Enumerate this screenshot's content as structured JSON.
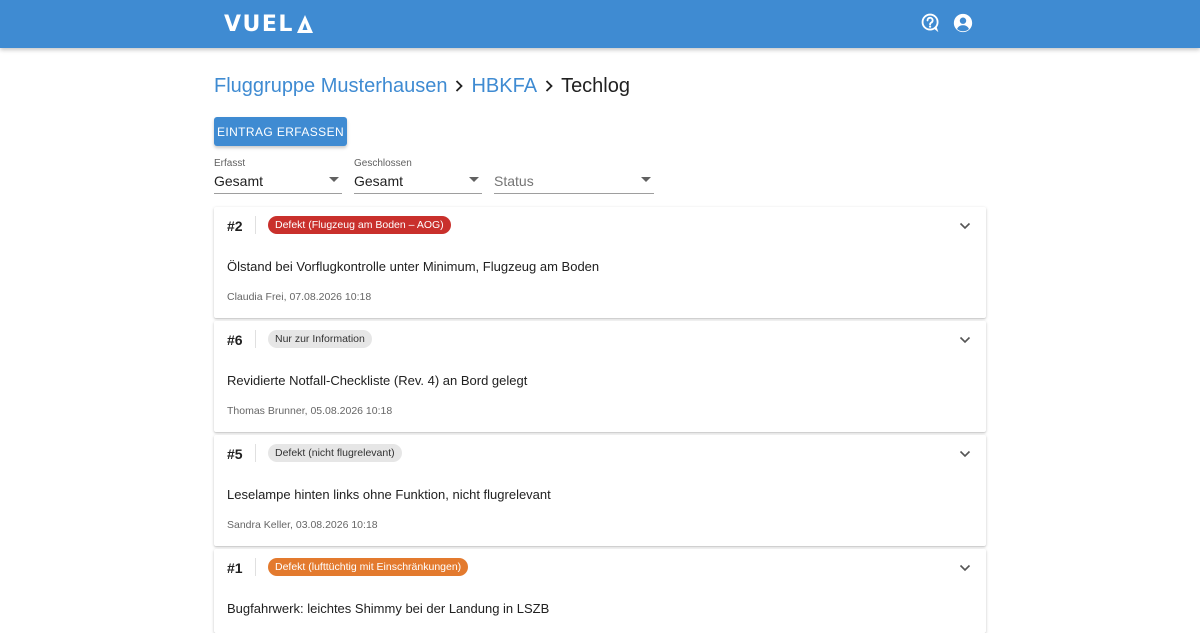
{
  "appbar": {
    "logo_text": "VUEL",
    "logo_mark": "triangle-a-mark",
    "help_icon": "help-circle-icon",
    "account_icon": "account-circle-icon",
    "color": "#3f8bd2"
  },
  "breadcrumb": {
    "group": "Fluggruppe Musterhausen",
    "aircraft": "HBKFA",
    "current": "Techlog"
  },
  "actions": {
    "add_entry": "Eintrag erfassen"
  },
  "filters": {
    "recorded": {
      "label": "Erfasst",
      "value": "Gesamt"
    },
    "closed": {
      "label": "Geschlossen",
      "value": "Gesamt"
    },
    "status": {
      "placeholder": "Status"
    }
  },
  "entries": [
    {
      "id": "#2",
      "status": "Defekt (Flugzeug am Boden – AOG)",
      "status_color": "#c9302c",
      "title": "Ölstand bei Vorflugkontrolle unter Minimum, Flugzeug am Boden",
      "meta": "Claudia Frei, 07.08.2026 10:18"
    },
    {
      "id": "#6",
      "status": "Nur zur Information",
      "status_color": "#e6e6e6",
      "title": "Revidierte Notfall-Checkliste (Rev. 4) an Bord gelegt",
      "meta": "Thomas Brunner, 05.08.2026 10:18"
    },
    {
      "id": "#5",
      "status": "Defekt (nicht flugrelevant)",
      "status_color": "#e6e6e6",
      "title": "Leselampe hinten links ohne Funktion, nicht flugrelevant",
      "meta": "Sandra Keller, 03.08.2026 10:18"
    },
    {
      "id": "#1",
      "status": "Defekt (lufttüchtig mit Einschränkungen)",
      "status_color": "#e37a2e",
      "title": "Bugfahrwerk: leichtes Shimmy bei der Landung in LSZB",
      "meta": ""
    }
  ]
}
